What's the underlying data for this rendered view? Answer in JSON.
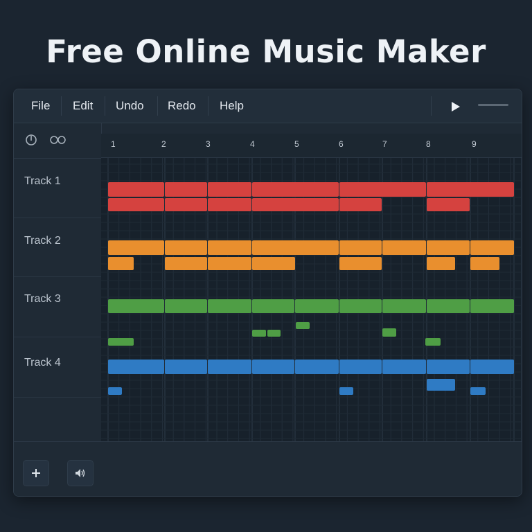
{
  "headline": "Free Online Music Maker",
  "menu": {
    "items": [
      "File",
      "Edit",
      "Undo",
      "Redo",
      "Help"
    ]
  },
  "toolbar": {
    "play_icon": "play-icon",
    "volume_slider_icon": "volume-slider"
  },
  "sidebar": {
    "top_icons": [
      "metronome-icon",
      "loop-icon"
    ],
    "tracks": [
      "Track 1",
      "Track 2",
      "Track 3",
      "Track 4"
    ]
  },
  "bottom": {
    "add_icon": "plus-icon",
    "volume_icon": "speaker-icon"
  },
  "ruler": {
    "bars": [
      "1",
      "2",
      "3",
      "4",
      "5",
      "6",
      "7",
      "8",
      "9"
    ]
  },
  "colors": {
    "track1": "#d5423f",
    "track2": "#e98f2e",
    "track3": "#4f9e45",
    "track4": "#2f7bc4"
  }
}
